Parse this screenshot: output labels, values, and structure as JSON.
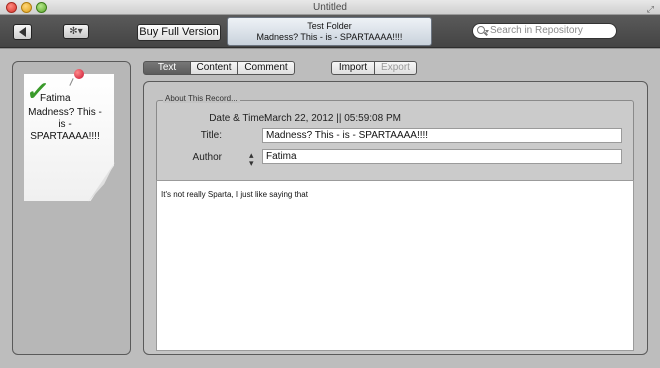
{
  "window": {
    "title": "Untitled"
  },
  "toolbar": {
    "buy_label": "Buy Full Version",
    "folder_line1": "Test Folder",
    "folder_line2": "Madness? This - is - SPARTAAAA!!!!",
    "search_placeholder": "Search in Repository"
  },
  "sidebar": {
    "note_author": "Fatima",
    "note_title": "Madness? This - is - SPARTAAAA!!!!"
  },
  "tabs": [
    "Text",
    "Content",
    "Comment"
  ],
  "actions": {
    "import": "Import",
    "export": "Export"
  },
  "record": {
    "legend": "About This Record...",
    "datetime_label": "Date & Time:",
    "datetime_value": "March 22, 2012 || 05:59:08 PM",
    "title_label": "Title:",
    "title_value": "Madness? This - is - SPARTAAAA!!!!",
    "author_label": "Author",
    "author_value": "Fatima"
  },
  "body_text": "It's not really Sparta, I just like saying that",
  "colors": {
    "selected_tab": "#6a6a6a",
    "checkmark": "#3a9a2a",
    "pin": "#c8102e"
  }
}
